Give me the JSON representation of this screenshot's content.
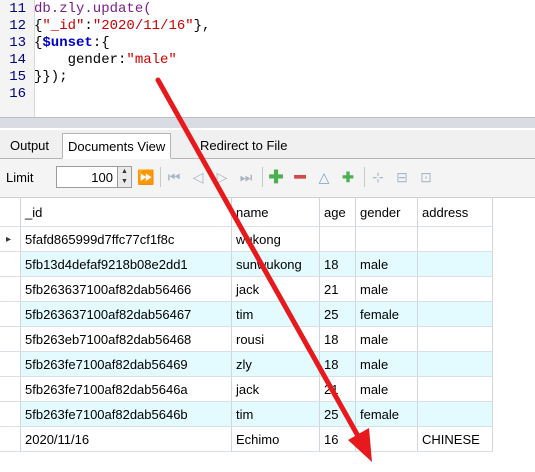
{
  "editor": {
    "lines": [
      {
        "num": "11",
        "parts": [
          {
            "t": "db.zly.update(",
            "c": "fn"
          }
        ]
      },
      {
        "num": "12",
        "parts": [
          {
            "t": "{",
            "c": "code"
          },
          {
            "t": "\"_id\"",
            "c": "str"
          },
          {
            "t": ":",
            "c": "code"
          },
          {
            "t": "\"2020/11/16\"",
            "c": "str"
          },
          {
            "t": "},",
            "c": "code"
          }
        ]
      },
      {
        "num": "13",
        "parts": [
          {
            "t": "{",
            "c": "code"
          },
          {
            "t": "$unset",
            "c": "kw"
          },
          {
            "t": ":{",
            "c": "code"
          }
        ]
      },
      {
        "num": "14",
        "parts": [
          {
            "t": "    gender",
            "c": "code"
          },
          {
            "t": ":",
            "c": "code"
          },
          {
            "t": "\"male\"",
            "c": "str"
          }
        ]
      },
      {
        "num": "15",
        "parts": [
          {
            "t": "}});",
            "c": "code"
          }
        ]
      },
      {
        "num": "16",
        "parts": []
      }
    ]
  },
  "tabs": [
    {
      "label": "Output",
      "active": false
    },
    {
      "label": "Documents View",
      "active": true
    },
    {
      "label": "Redirect to File",
      "active": false
    }
  ],
  "toolbar": {
    "limit_label": "Limit",
    "limit_value": "100"
  },
  "table": {
    "columns": [
      "_id",
      "name",
      "age",
      "gender",
      "address"
    ],
    "rows": [
      [
        "5fafd865999d7ffc77cf1f8c",
        "wukong",
        "",
        "",
        ""
      ],
      [
        "5fb13d4defaf9218b08e2dd1",
        "sunwukong",
        "18",
        "male",
        ""
      ],
      [
        "5fb263637100af82dab56466",
        "jack",
        "21",
        "male",
        ""
      ],
      [
        "5fb263637100af82dab56467",
        "tim",
        "25",
        "female",
        ""
      ],
      [
        "5fb263eb7100af82dab56468",
        "rousi",
        "18",
        "male",
        ""
      ],
      [
        "5fb263fe7100af82dab56469",
        "zly",
        "18",
        "male",
        ""
      ],
      [
        "5fb263fe7100af82dab5646a",
        "jack",
        "21",
        "male",
        ""
      ],
      [
        "5fb263fe7100af82dab5646b",
        "tim",
        "25",
        "female",
        ""
      ],
      [
        "2020/11/16",
        "Echimo",
        "16",
        "",
        "CHINESE"
      ]
    ]
  },
  "colors": {
    "arrow": "#e8191c",
    "alt_row": "#e3fbff"
  }
}
